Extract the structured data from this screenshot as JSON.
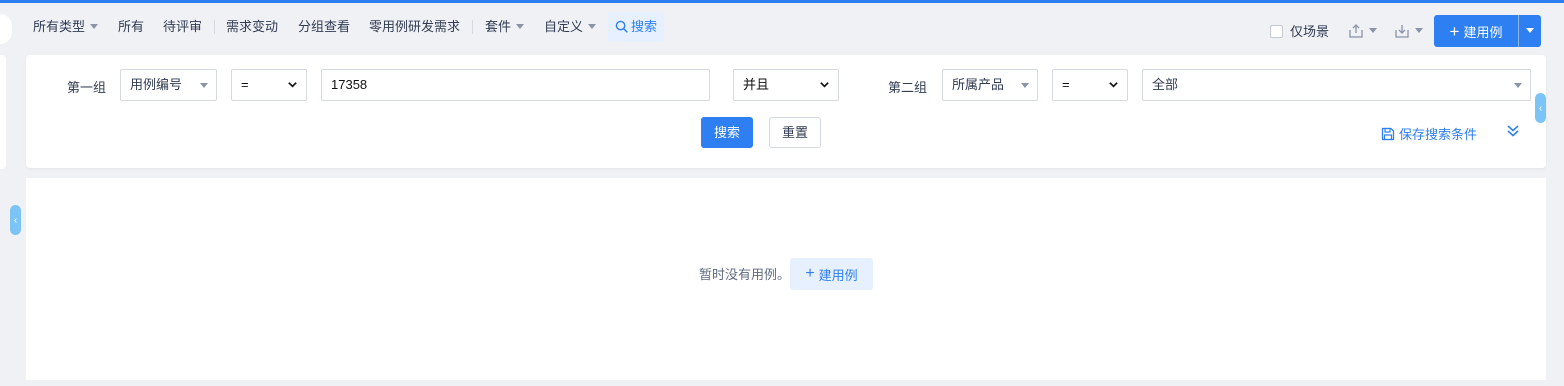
{
  "nav": {
    "all_types": "所有类型",
    "all": "所有",
    "pending_review": "待评审",
    "requirement_change": "需求变动",
    "group_view": "分组查看",
    "zero_case_requirement": "零用例研发需求",
    "suite": "套件",
    "custom": "自定义",
    "search_tab": "搜索",
    "scene_only": "仅场景",
    "create_case": "建用例"
  },
  "search_form": {
    "group1_label": "第一组",
    "group1_field": "用例编号",
    "group1_operator": "=",
    "group1_value": "17358",
    "logic_operator": "并且",
    "group2_label": "第二组",
    "group2_field": "所属产品",
    "group2_operator": "=",
    "group2_value": "全部",
    "search_button": "搜索",
    "reset_button": "重置",
    "save_condition": "保存搜索条件"
  },
  "empty_state": {
    "message": "暂时没有用例。",
    "create_button": "建用例"
  },
  "colors": {
    "primary": "#2e7ff1",
    "primary_light": "#e6f0fe",
    "background": "#eff1f5"
  }
}
